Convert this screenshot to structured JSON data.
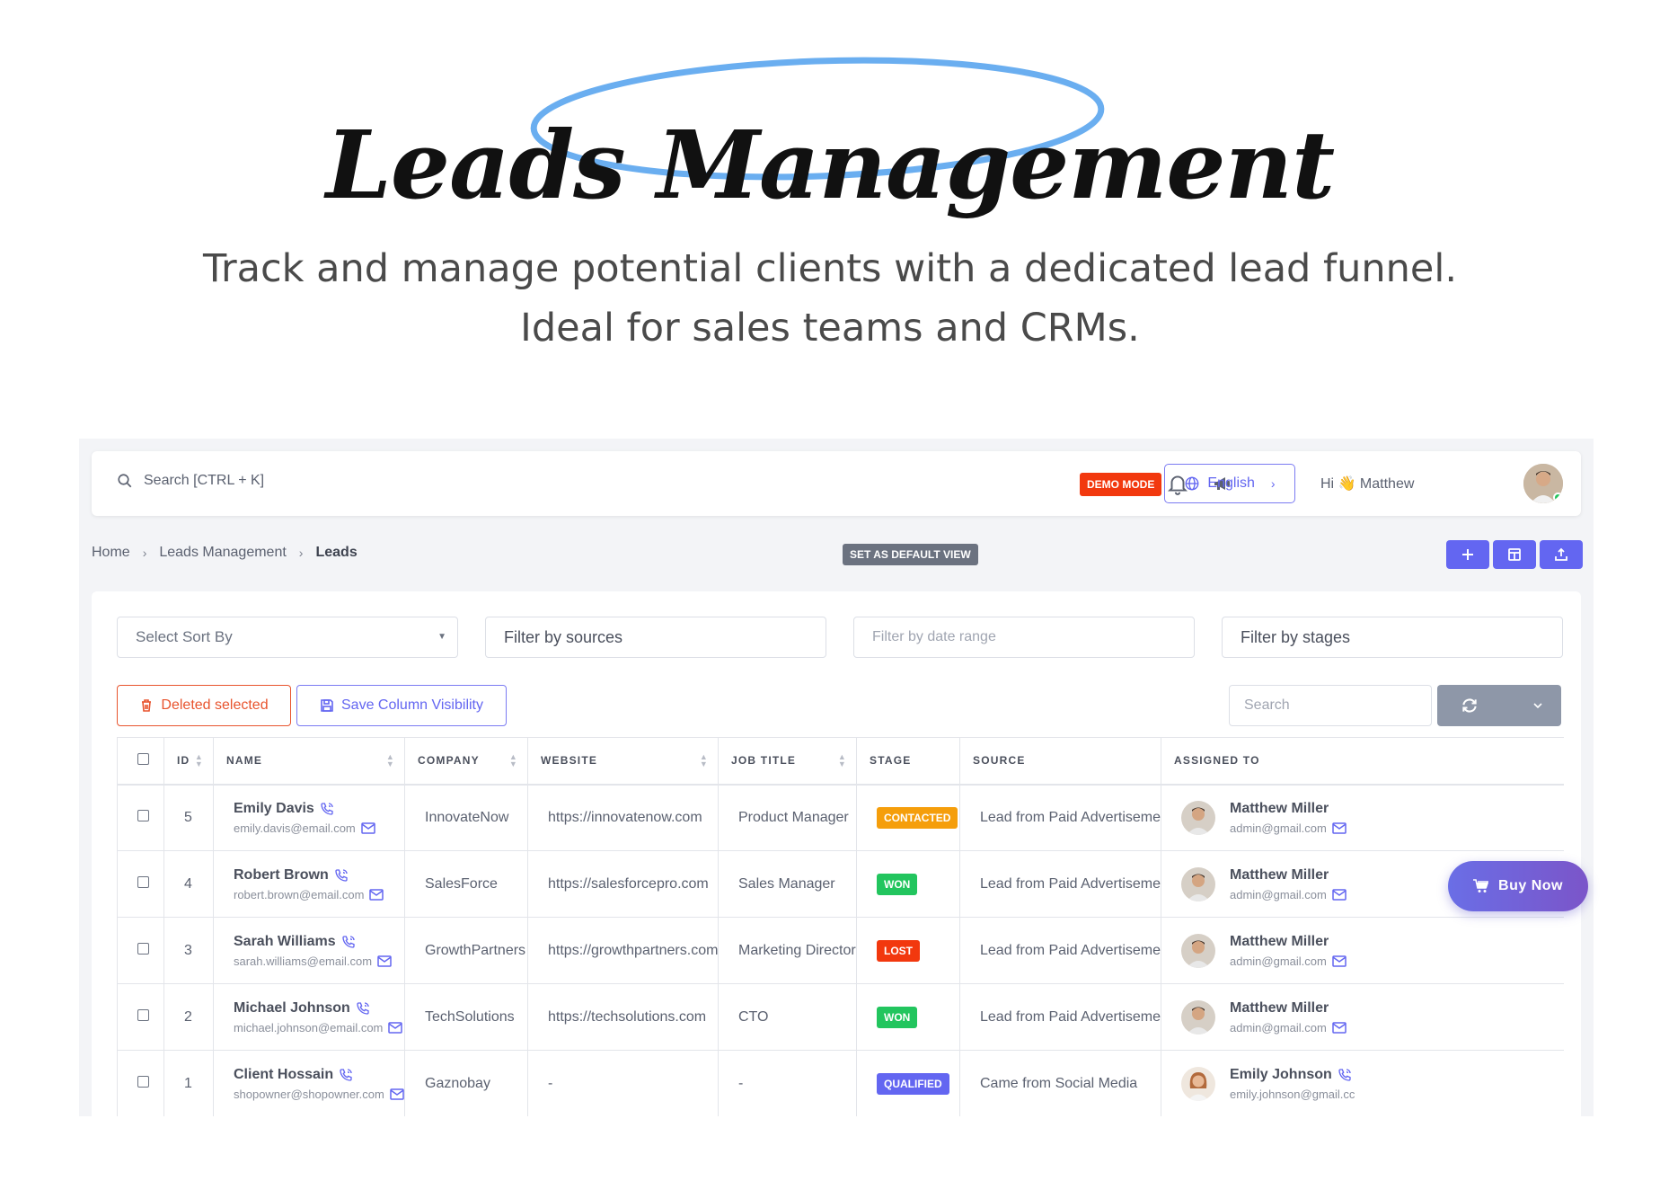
{
  "hero": {
    "title": "Leads Management",
    "subtitle": "Track and manage potential clients with a dedicated lead funnel. Ideal for sales teams and CRMs."
  },
  "topbar": {
    "search_placeholder": "Search [CTRL + K]",
    "demo_badge": "DEMO MODE",
    "language": "English",
    "greeting": "Hi 👋 Matthew"
  },
  "breadcrumb": {
    "home": "Home",
    "section": "Leads Management",
    "current": "Leads"
  },
  "set_default_view": "SET AS DEFAULT VIEW",
  "filters": {
    "sort_placeholder": "Select Sort By",
    "sources_placeholder": "Filter by sources",
    "date_placeholder": "Filter by date range",
    "stages_placeholder": "Filter by stages"
  },
  "toolbar": {
    "delete_label": "Deleted selected",
    "save_columns_label": "Save Column Visibility",
    "table_search_placeholder": "Search"
  },
  "table": {
    "columns": [
      "ID",
      "NAME",
      "COMPANY",
      "WEBSITE",
      "JOB TITLE",
      "STAGE",
      "SOURCE",
      "ASSIGNED TO"
    ],
    "rows": [
      {
        "id": "5",
        "name": "Emily Davis",
        "email": "emily.davis@email.com",
        "company": "InnovateNow",
        "website": "https://innovatenow.com",
        "job_title": "Product Manager",
        "stage": "CONTACTED",
        "stage_color": "#f59e0b",
        "source": "Lead from Paid Advertisement",
        "assignee": "Matthew Miller",
        "assignee_email": "admin@gmail.com"
      },
      {
        "id": "4",
        "name": "Robert Brown",
        "email": "robert.brown@email.com",
        "company": "SalesForce",
        "website": "https://salesforcepro.com",
        "job_title": "Sales Manager",
        "stage": "WON",
        "stage_color": "#22c55e",
        "source": "Lead from Paid Advertisement",
        "assignee": "Matthew Miller",
        "assignee_email": "admin@gmail.com"
      },
      {
        "id": "3",
        "name": "Sarah Williams",
        "email": "sarah.williams@email.com",
        "company": "GrowthPartners",
        "website": "https://growthpartners.com",
        "job_title": "Marketing Director",
        "stage": "LOST",
        "stage_color": "#f2380e",
        "source": "Lead from Paid Advertisement",
        "assignee": "Matthew Miller",
        "assignee_email": "admin@gmail.com"
      },
      {
        "id": "2",
        "name": "Michael Johnson",
        "email": "michael.johnson@email.com",
        "company": "TechSolutions",
        "website": "https://techsolutions.com",
        "job_title": "CTO",
        "stage": "WON",
        "stage_color": "#22c55e",
        "source": "Lead from Paid Advertisement",
        "assignee": "Matthew Miller",
        "assignee_email": "admin@gmail.com"
      },
      {
        "id": "1",
        "name": "Client Hossain",
        "email": "shopowner@shopowner.com",
        "company": "Gaznobay",
        "website": "-",
        "job_title": "-",
        "stage": "QUALIFIED",
        "stage_color": "#6366f1",
        "source": "Came from Social Media",
        "assignee": "Emily Johnson",
        "assignee_email": "emily.johnson@gmail.cc"
      }
    ]
  },
  "buy_now": "Buy Now",
  "colors": {
    "primary": "#6366f1",
    "danger": "#f2380e",
    "success": "#22c55e",
    "warning": "#f59e0b"
  },
  "icons": {
    "search": "search-icon",
    "bell": "bell-icon",
    "megaphone": "megaphone-icon",
    "globe": "globe-icon",
    "phone": "phone-icon",
    "mail": "mail-icon",
    "trash": "trash-icon",
    "save": "save-icon",
    "plus": "plus-icon",
    "layout": "layout-icon",
    "upload": "upload-icon",
    "refresh": "refresh-icon",
    "cart": "cart-icon"
  }
}
